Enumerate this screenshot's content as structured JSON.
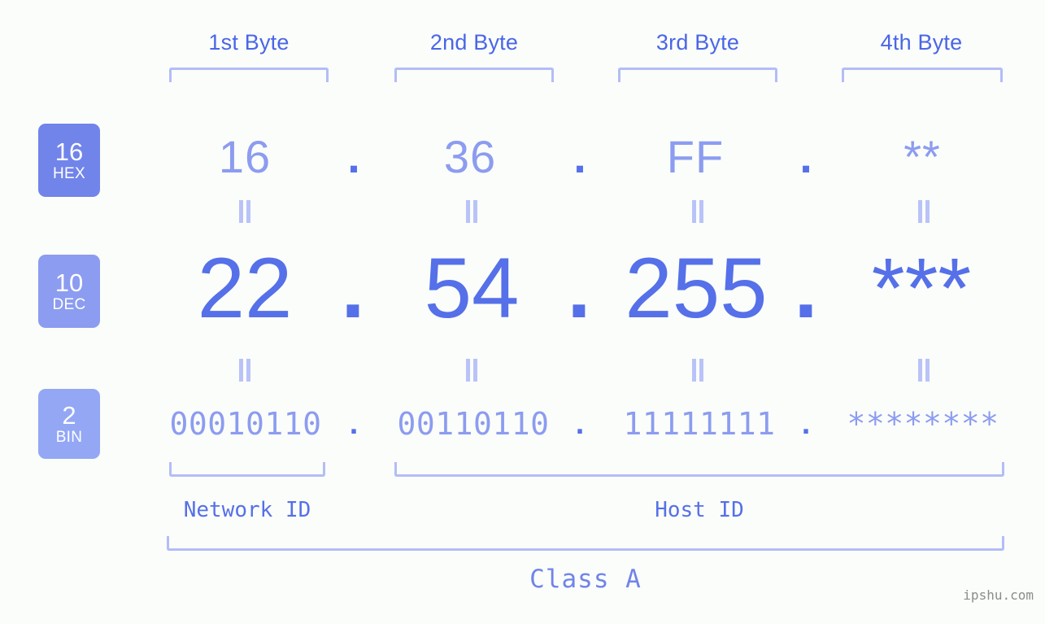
{
  "background_color": "#fbfdfa",
  "accent_colors": {
    "strong_blue": "#5570e8",
    "mid_blue": "#8c9cf0",
    "light_blue": "#b3bdf7",
    "badge_hex": "#7184ea",
    "badge_dec": "#8c9cf0",
    "badge_bin": "#93a7f5",
    "watermark_gray": "#8c8c8c"
  },
  "byte_headers": [
    {
      "label": "1st Byte"
    },
    {
      "label": "2nd Byte"
    },
    {
      "label": "3rd Byte"
    },
    {
      "label": "4th Byte"
    }
  ],
  "bases": [
    {
      "radix": "16",
      "name": "HEX"
    },
    {
      "radix": "10",
      "name": "DEC"
    },
    {
      "radix": "2",
      "name": "BIN"
    }
  ],
  "rows": {
    "hex": {
      "base_radix": "16",
      "base_name": "HEX",
      "values": [
        "16",
        "36",
        "FF",
        "**"
      ],
      "separator": "."
    },
    "dec": {
      "base_radix": "10",
      "base_name": "DEC",
      "values": [
        "22",
        "54",
        "255",
        "***"
      ],
      "separator": "."
    },
    "bin": {
      "base_radix": "2",
      "base_name": "BIN",
      "values": [
        "00010110",
        "00110110",
        "11111111",
        "********"
      ],
      "separator": "."
    }
  },
  "equals_marks": {
    "glyph": "||",
    "count_per_row": 4
  },
  "segments": {
    "network_id": "Network ID",
    "host_id": "Host ID"
  },
  "class_label": "Class A",
  "watermark": "ipshu.com"
}
